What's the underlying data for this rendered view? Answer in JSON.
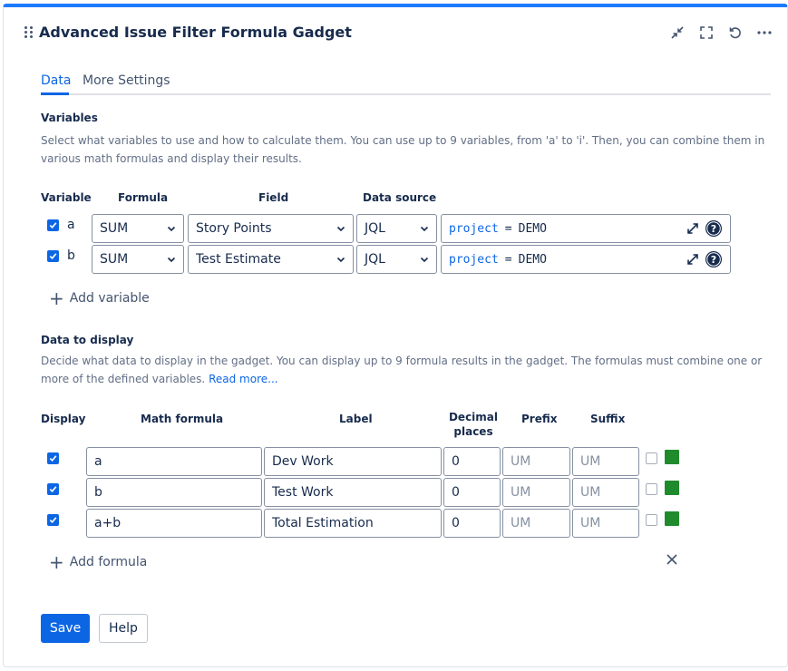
{
  "gadget": {
    "title": "Advanced Issue Filter Formula Gadget",
    "header_icons": [
      "minimize-icon",
      "fullscreen-icon",
      "refresh-icon",
      "more-icon"
    ]
  },
  "tabs": [
    {
      "label": "Data",
      "active": true
    },
    {
      "label": "More Settings",
      "active": false
    }
  ],
  "variables": {
    "heading": "Variables",
    "description": "Select what variables to use and how to calculate them. You can use up to 9 variables, from 'a' to 'i'. Then, you can combine them in various math formulas and display their results.",
    "columns": {
      "variable": "Variable",
      "formula": "Formula",
      "field": "Field",
      "data_source": "Data source"
    },
    "rows": [
      {
        "checked": true,
        "letter": "a",
        "formula": "SUM",
        "field": "Story Points",
        "source": "JQL",
        "jql_keyword": "project",
        "jql_operator": "=",
        "jql_value": "DEMO"
      },
      {
        "checked": true,
        "letter": "b",
        "formula": "SUM",
        "field": "Test Estimate",
        "source": "JQL",
        "jql_keyword": "project",
        "jql_operator": "=",
        "jql_value": "DEMO"
      }
    ],
    "add_label": "Add variable"
  },
  "display": {
    "heading": "Data to display",
    "description": "Decide what data to display in the gadget. You can display up to 9 formula results in the gadget. The formulas must combine one or more of the defined variables.",
    "read_more": "Read more...",
    "columns": {
      "display": "Display",
      "math_formula": "Math formula",
      "label": "Label",
      "decimal_1": "Decimal",
      "decimal_2": "places",
      "prefix": "Prefix",
      "suffix": "Suffix"
    },
    "rows": [
      {
        "checked": true,
        "formula": "a",
        "label": "Dev Work",
        "decimals": "0",
        "prefix_placeholder": "UM",
        "suffix_placeholder": "UM",
        "extra_checked": false,
        "color": "#1f8b2d"
      },
      {
        "checked": true,
        "formula": "b",
        "label": "Test Work",
        "decimals": "0",
        "prefix_placeholder": "UM",
        "suffix_placeholder": "UM",
        "extra_checked": false,
        "color": "#1f8b2d"
      },
      {
        "checked": true,
        "formula": "a+b",
        "label": "Total Estimation",
        "decimals": "0",
        "prefix_placeholder": "UM",
        "suffix_placeholder": "UM",
        "extra_checked": false,
        "color": "#1f8b2d"
      }
    ],
    "add_label": "Add formula"
  },
  "footer": {
    "save_label": "Save",
    "help_label": "Help"
  },
  "colors": {
    "accent": "#0c66e4",
    "top_border": "#1d7afc",
    "swatch": "#1f8b2d"
  }
}
